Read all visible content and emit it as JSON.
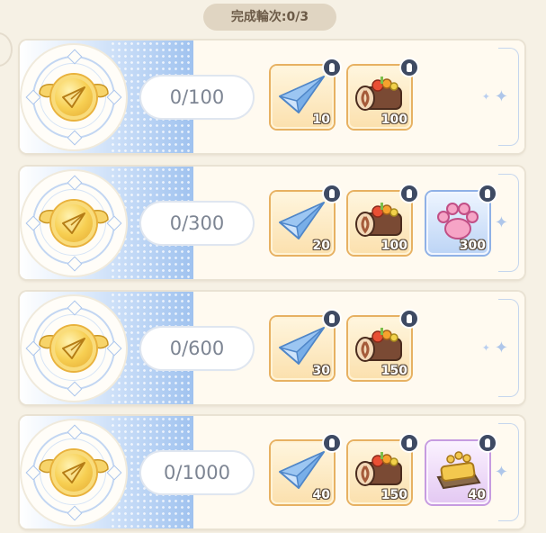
{
  "header": {
    "rounds_label": "完成輪次:0/3"
  },
  "rows": [
    {
      "progress": "0/100",
      "rewards": [
        {
          "icon": "paper-plane-icon",
          "qty": "10",
          "rarity": "orange"
        },
        {
          "icon": "cake-roll-icon",
          "qty": "100",
          "rarity": "orange"
        }
      ]
    },
    {
      "progress": "0/300",
      "rewards": [
        {
          "icon": "paper-plane-icon",
          "qty": "20",
          "rarity": "orange"
        },
        {
          "icon": "cake-roll-icon",
          "qty": "100",
          "rarity": "orange"
        },
        {
          "icon": "paw-icon",
          "qty": "300",
          "rarity": "blue"
        }
      ]
    },
    {
      "progress": "0/600",
      "rewards": [
        {
          "icon": "paper-plane-icon",
          "qty": "30",
          "rarity": "orange"
        },
        {
          "icon": "cake-roll-icon",
          "qty": "150",
          "rarity": "orange"
        }
      ]
    },
    {
      "progress": "0/1000",
      "rewards": [
        {
          "icon": "paper-plane-icon",
          "qty": "40",
          "rarity": "orange"
        },
        {
          "icon": "cake-roll-icon",
          "qty": "150",
          "rarity": "orange"
        },
        {
          "icon": "golden-paw-block-icon",
          "qty": "40",
          "rarity": "purple"
        }
      ]
    }
  ],
  "colors": {
    "background": "#f6f1e5",
    "accent_blue": "#9fc2ef",
    "rarity_orange": "#e7b162",
    "rarity_blue": "#8fb1e6",
    "rarity_purple": "#c69be0"
  }
}
